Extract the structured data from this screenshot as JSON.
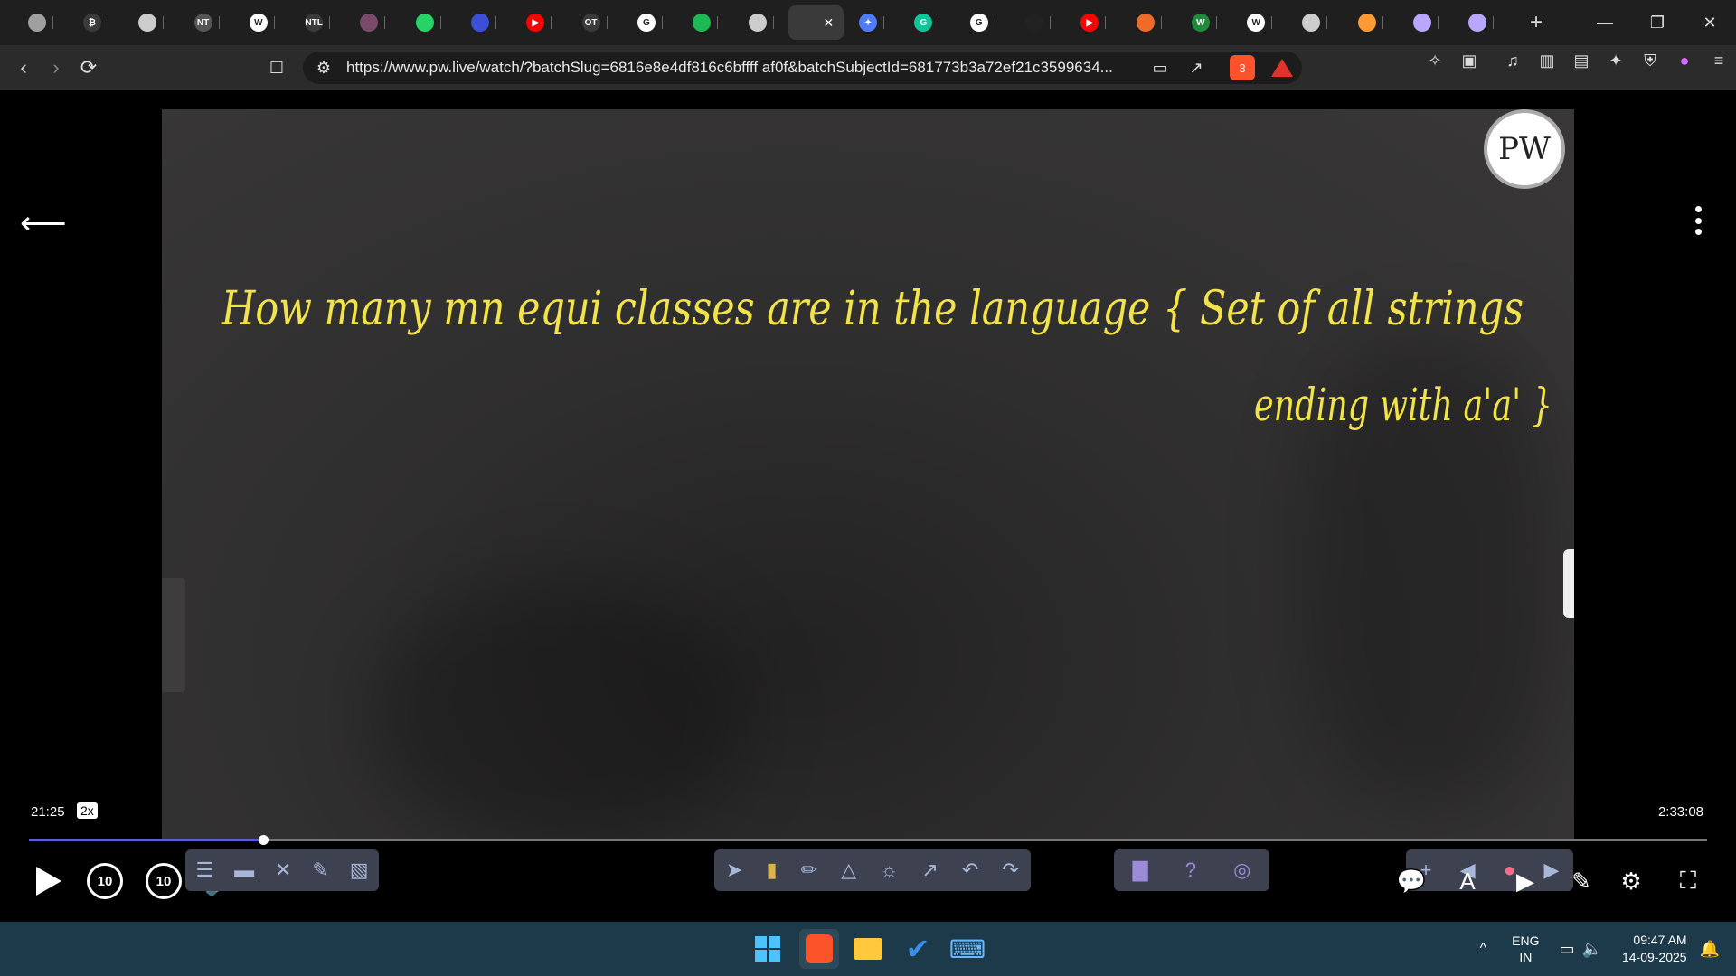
{
  "browser": {
    "tabs": [
      {
        "icon": "chatgpt-icon",
        "color": "#a0a0a0",
        "letter": ""
      },
      {
        "icon": "bitcoin-icon",
        "color": "#3a3a3a",
        "letter": "₿"
      },
      {
        "icon": "globe-icon",
        "color": "#cccccc",
        "letter": ""
      },
      {
        "icon": "nt-icon",
        "color": "#555555",
        "letter": "NT"
      },
      {
        "icon": "wordpress-icon",
        "color": "#ffffff",
        "letter": "W"
      },
      {
        "icon": "ntl-icon",
        "color": "#3a3a3a",
        "letter": "NTL"
      },
      {
        "icon": "avatar-icon",
        "color": "#7a4a6a",
        "letter": ""
      },
      {
        "icon": "whatsapp-icon",
        "color": "#25d366",
        "letter": ""
      },
      {
        "icon": "bookmark-app-icon",
        "color": "#3b4fd8",
        "letter": ""
      },
      {
        "icon": "youtube-icon",
        "color": "#ff0000",
        "letter": "▶"
      },
      {
        "icon": "ot-icon",
        "color": "#3a3a3a",
        "letter": "OT"
      },
      {
        "icon": "google-icon",
        "color": "#ffffff",
        "letter": "G"
      },
      {
        "icon": "spotify-icon",
        "color": "#1db954",
        "letter": ""
      },
      {
        "icon": "globe-icon",
        "color": "#cccccc",
        "letter": ""
      },
      {
        "icon": "pw-tab-icon",
        "color": "#3a3a3a",
        "letter": ""
      },
      {
        "icon": "gemini-icon",
        "color": "#4f7cff",
        "letter": "✦"
      },
      {
        "icon": "grammarly-icon",
        "color": "#15c39a",
        "letter": "G"
      },
      {
        "icon": "google-icon",
        "color": "#ffffff",
        "letter": "G"
      },
      {
        "icon": "window-icon",
        "color": "#222222",
        "letter": ""
      },
      {
        "icon": "youtube-icon",
        "color": "#ff0000",
        "letter": "▶"
      },
      {
        "icon": "orange-icon",
        "color": "#f06a2a",
        "letter": ""
      },
      {
        "icon": "green-w-icon",
        "color": "#1f8a3a",
        "letter": "W"
      },
      {
        "icon": "wikipedia-icon",
        "color": "#ffffff",
        "letter": "W"
      },
      {
        "icon": "globe-icon",
        "color": "#cccccc",
        "letter": ""
      },
      {
        "icon": "india-flag-icon",
        "color": "#ff9933",
        "letter": ""
      },
      {
        "icon": "purple-circle-icon",
        "color": "#b9a6ff",
        "letter": ""
      },
      {
        "icon": "purple-circle-icon",
        "color": "#b9a6ff",
        "letter": ""
      }
    ],
    "active_tab_index": 14,
    "url": "https://www.pw.live/watch/?batchSlug=6816e8e4df816c6bffff af0f&batchSubjectId=681773b3a72ef21c3599634...",
    "brave_badge": "3"
  },
  "player": {
    "current_time": "21:25",
    "speed": "2x",
    "total_time": "2:33:08",
    "progress_fraction": 0.1397,
    "rewind_label": "10",
    "forward_label": "10"
  },
  "board": {
    "line1": "How many mn equi classes are in the language { Set of all strings",
    "line2": "ending with a'a' }",
    "logo": "PW"
  },
  "taskbar": {
    "lang_top": "ENG",
    "lang_bottom": "IN",
    "time": "09:47 AM",
    "date": "14-09-2025"
  }
}
